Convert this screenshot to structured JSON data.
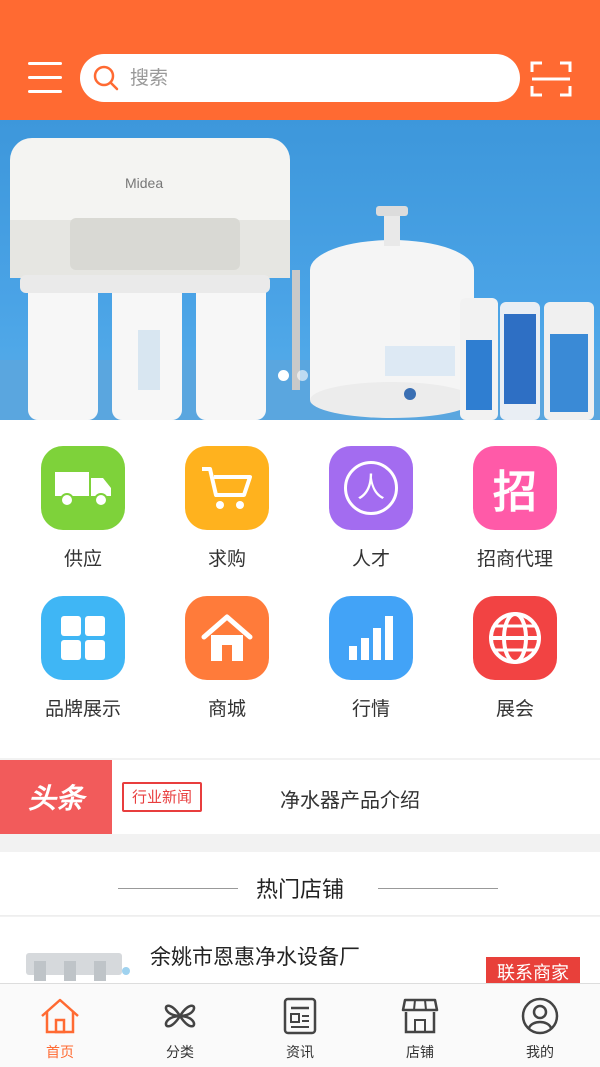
{
  "colors": {
    "brand": "#ff6a32",
    "accent_red": "#e8403a",
    "headline_red": "#f25b5b"
  },
  "search": {
    "placeholder": "搜索"
  },
  "banner": {
    "brand_text": "Midea",
    "slide_count": 2,
    "active_slide": 1
  },
  "categories": [
    {
      "label": "供应",
      "icon": "truck-icon",
      "color": "#7ed23a"
    },
    {
      "label": "求购",
      "icon": "cart-icon",
      "color": "#ffb21e"
    },
    {
      "label": "人才",
      "icon": "person-icon",
      "color": "#a36cf0",
      "glyph": "人"
    },
    {
      "label": "招商代理",
      "icon": "recruit-icon",
      "color": "#ff5aa8",
      "glyph": "招"
    },
    {
      "label": "品牌展示",
      "icon": "grid-icon",
      "color": "#3fb6f5"
    },
    {
      "label": "商城",
      "icon": "house-icon",
      "color": "#ff7b3a"
    },
    {
      "label": "行情",
      "icon": "bar-chart-icon",
      "color": "#42a3f7"
    },
    {
      "label": "展会",
      "icon": "globe-icon",
      "color": "#f24343"
    }
  ],
  "headline": {
    "logo": "头条",
    "tag": "行业新闻",
    "text": "净水器产品介绍"
  },
  "hot_shops": {
    "title": "热门店铺",
    "items": [
      {
        "name": "余姚市恩惠净水设备厂",
        "contact_label": "联系商家"
      }
    ]
  },
  "tabbar": [
    {
      "label": "首页",
      "icon": "home-icon",
      "active": true
    },
    {
      "label": "分类",
      "icon": "category-icon",
      "active": false
    },
    {
      "label": "资讯",
      "icon": "news-icon",
      "active": false
    },
    {
      "label": "店铺",
      "icon": "store-icon",
      "active": false
    },
    {
      "label": "我的",
      "icon": "user-icon",
      "active": false
    }
  ]
}
